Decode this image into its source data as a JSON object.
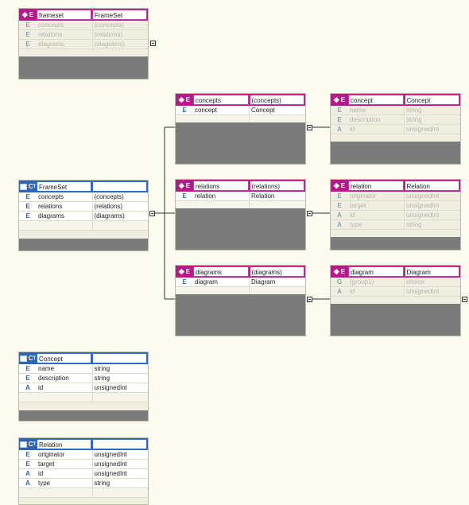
{
  "boxes": {
    "frameset_el": {
      "kind": "E",
      "name": "frameset",
      "type": "FrameSet",
      "rows": [
        {
          "icon": "E",
          "name": "concepts",
          "type": "(concepts)"
        },
        {
          "icon": "E",
          "name": "relations",
          "type": "(relations)"
        },
        {
          "icon": "E",
          "name": "diagrams",
          "type": "(diagrams)"
        }
      ]
    },
    "frameset_ct": {
      "kind": "CT",
      "name": "FrameSet",
      "type": "",
      "rows": [
        {
          "icon": "E",
          "name": "concepts",
          "type": "(concepts)"
        },
        {
          "icon": "E",
          "name": "relations",
          "type": "(relations)"
        },
        {
          "icon": "E",
          "name": "diagrams",
          "type": "(diagrams)"
        }
      ]
    },
    "concepts_el": {
      "kind": "E",
      "name": "concepts",
      "type": "(concepts)",
      "rows": [
        {
          "icon": "E",
          "name": "concept",
          "type": "Concept"
        }
      ]
    },
    "relations_el": {
      "kind": "E",
      "name": "relations",
      "type": "(relations)",
      "rows": [
        {
          "icon": "E",
          "name": "relation",
          "type": "Relation"
        }
      ]
    },
    "diagrams_el": {
      "kind": "E",
      "name": "diagrams",
      "type": "(diagrams)",
      "rows": [
        {
          "icon": "E",
          "name": "diagram",
          "type": "Diagram"
        }
      ]
    },
    "concept_el": {
      "kind": "E",
      "name": "concept",
      "type": "Concept",
      "rows": [
        {
          "icon": "E",
          "name": "name",
          "type": "string"
        },
        {
          "icon": "E",
          "name": "description",
          "type": "string"
        },
        {
          "icon": "A",
          "name": "id",
          "type": "unsignedInt"
        }
      ]
    },
    "relation_el": {
      "kind": "E",
      "name": "relation",
      "type": "Relation",
      "rows": [
        {
          "icon": "E",
          "name": "originator",
          "type": "unsignedInt"
        },
        {
          "icon": "E",
          "name": "target",
          "type": "unsignedInt"
        },
        {
          "icon": "A",
          "name": "id",
          "type": "unsignedInt"
        },
        {
          "icon": "A",
          "name": "type",
          "type": "string"
        }
      ]
    },
    "diagram_el": {
      "kind": "E",
      "name": "diagram",
      "type": "Diagram",
      "rows": [
        {
          "icon": "G",
          "name": "(group1)",
          "type": "choice"
        },
        {
          "icon": "A",
          "name": "id",
          "type": "unsignedInt"
        }
      ]
    },
    "concept_ct": {
      "kind": "CT",
      "name": "Concept",
      "type": "",
      "rows": [
        {
          "icon": "E",
          "name": "name",
          "type": "string"
        },
        {
          "icon": "E",
          "name": "description",
          "type": "string"
        },
        {
          "icon": "A",
          "name": "id",
          "type": "unsignedInt"
        }
      ]
    },
    "relation_ct": {
      "kind": "CT",
      "name": "Relation",
      "type": "",
      "rows": [
        {
          "icon": "E",
          "name": "originator",
          "type": "unsignedInt"
        },
        {
          "icon": "E",
          "name": "target",
          "type": "unsignedInt"
        },
        {
          "icon": "A",
          "name": "id",
          "type": "unsignedInt"
        },
        {
          "icon": "A",
          "name": "type",
          "type": "string"
        }
      ]
    }
  },
  "colors": {
    "element_header": "#b7198b",
    "complex_type_header": "#2f64b3",
    "canvas": "#fbfbf0",
    "footer": "#7b7b7b"
  },
  "icons": {
    "element_marker": "diamond-icon",
    "complex_type_marker": "complex-type-icon",
    "collapse": "minus-box-icon"
  }
}
